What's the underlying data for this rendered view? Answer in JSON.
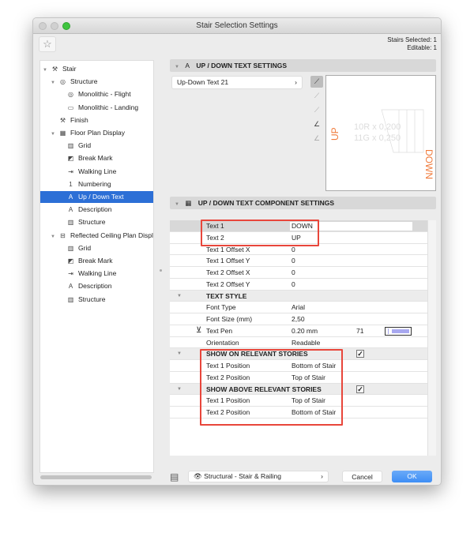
{
  "window": {
    "title": "Stair Selection Settings"
  },
  "header": {
    "stairs_selected": "Stairs Selected: 1",
    "editable": "Editable: 1"
  },
  "tree": [
    {
      "label": "Stair",
      "level": 0,
      "icon": "stair-icon",
      "expanded": true
    },
    {
      "label": "Structure",
      "level": 1,
      "icon": "structure-icon",
      "expanded": true
    },
    {
      "label": "Monolithic - Flight",
      "level": 2,
      "icon": "flight-icon"
    },
    {
      "label": "Monolithic - Landing",
      "level": 2,
      "icon": "landing-icon"
    },
    {
      "label": "Finish",
      "level": 1,
      "icon": "finish-icon"
    },
    {
      "label": "Floor Plan Display",
      "level": 1,
      "icon": "floor-plan-icon",
      "expanded": true
    },
    {
      "label": "Grid",
      "level": 2,
      "icon": "grid-icon"
    },
    {
      "label": "Break Mark",
      "level": 2,
      "icon": "break-mark-icon"
    },
    {
      "label": "Walking Line",
      "level": 2,
      "icon": "walking-line-icon"
    },
    {
      "label": "Numbering",
      "level": 2,
      "icon": "numbering-icon"
    },
    {
      "label": "Up / Down Text",
      "level": 2,
      "icon": "text-icon",
      "selected": true
    },
    {
      "label": "Description",
      "level": 2,
      "icon": "text-icon"
    },
    {
      "label": "Structure",
      "level": 2,
      "icon": "grid-icon"
    },
    {
      "label": "Reflected Ceiling Plan Displ",
      "level": 1,
      "icon": "ceiling-plan-icon",
      "expanded": true
    },
    {
      "label": "Grid",
      "level": 2,
      "icon": "grid-icon"
    },
    {
      "label": "Break Mark",
      "level": 2,
      "icon": "break-mark-icon"
    },
    {
      "label": "Walking Line",
      "level": 2,
      "icon": "walking-line-icon"
    },
    {
      "label": "Description",
      "level": 2,
      "icon": "text-icon"
    },
    {
      "label": "Structure",
      "level": 2,
      "icon": "grid-icon"
    }
  ],
  "section1": {
    "title": "UP / DOWN TEXT SETTINGS",
    "preset": "Up-Down Text 21"
  },
  "preview": {
    "up": "UP",
    "down": "DOWN",
    "line1": "10R x 0,200",
    "line2": "11G x 0,250",
    "accent": "#f07a3a"
  },
  "section2": {
    "title": "UP / DOWN TEXT COMPONENT SETTINGS"
  },
  "rows": [
    {
      "name": "Text 1",
      "value": "DOWN",
      "editing": true
    },
    {
      "name": "Text 2",
      "value": "UP"
    },
    {
      "name": "Text 1 Offset X",
      "value": "0"
    },
    {
      "name": "Text 1 Offset Y",
      "value": "0"
    },
    {
      "name": "Text 2 Offset X",
      "value": "0"
    },
    {
      "name": "Text 2 Offset Y",
      "value": "0"
    },
    {
      "name": "TEXT STYLE",
      "header": true
    },
    {
      "name": "Font Type",
      "value": "Arial"
    },
    {
      "name": "Font Size (mm)",
      "value": "2,50"
    },
    {
      "name": "Text Pen",
      "value": "0.20 mm",
      "pen": "71",
      "pen_color": "#a8a8f0"
    },
    {
      "name": "Orientation",
      "value": "Readable"
    },
    {
      "name": "SHOW ON RELEVANT STORIES",
      "header": true,
      "checked": true
    },
    {
      "name": "Text 1 Position",
      "value": "Bottom of Stair"
    },
    {
      "name": "Text 2 Position",
      "value": "Top of Stair"
    },
    {
      "name": "SHOW ABOVE RELEVANT STORIES",
      "header": true,
      "checked": true
    },
    {
      "name": "Text 1 Position",
      "value": "Top of Stair"
    },
    {
      "name": "Text 2 Position",
      "value": "Bottom of Stair"
    }
  ],
  "footer": {
    "layer": "Structural - Stair & Railing",
    "cancel": "Cancel",
    "ok": "OK"
  },
  "colors": {
    "highlight": "#e8463b",
    "selection": "#2c6fd6",
    "ok": "#3d8ef5"
  }
}
